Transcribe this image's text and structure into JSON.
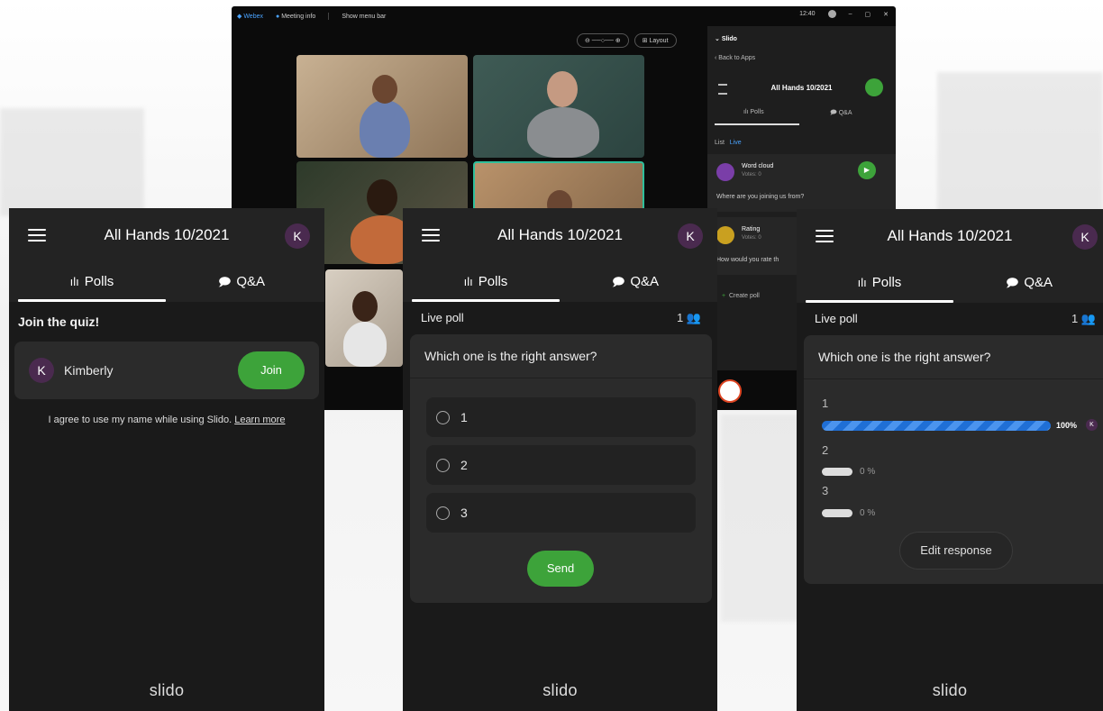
{
  "background_window": {
    "app_name": "Webex",
    "meeting_info": "Meeting info",
    "menu_bar": "Show menu bar",
    "clock": "12:40",
    "layout_label": "Layout",
    "slido_panel": {
      "title": "Slido",
      "back": "Back to Apps",
      "event_title": "All Hands 10/2021",
      "tab_polls": "Polls",
      "tab_qa": "Q&A",
      "filter_list": "List",
      "filter_live": "Live",
      "poll1_name": "Word cloud",
      "poll1_votes": "Votes: 0",
      "poll1_question": "Where are you joining us from?",
      "poll2_name": "Rating",
      "poll2_votes": "Votes: 0",
      "poll2_question": "How would you rate th",
      "create_poll": "Create poll"
    }
  },
  "phone1": {
    "title": "All Hands 10/2021",
    "avatar_initial": "K",
    "tab_polls": "Polls",
    "tab_qa": "Q&A",
    "section_title": "Join the quiz!",
    "user_initial": "K",
    "user_name": "Kimberly",
    "join_button": "Join",
    "consent_text": "I agree to use my name while using Slido.",
    "learn_more": "Learn more",
    "footer_logo": "slido"
  },
  "phone2": {
    "title": "All Hands 10/2021",
    "avatar_initial": "K",
    "tab_polls": "Polls",
    "tab_qa": "Q&A",
    "poll_status": "Live poll",
    "participant_count": "1",
    "question": "Which one is the right answer?",
    "options": [
      "1",
      "2",
      "3"
    ],
    "send_button": "Send",
    "footer_logo": "slido"
  },
  "phone3": {
    "title": "All Hands 10/2021",
    "avatar_initial": "K",
    "tab_polls": "Polls",
    "tab_qa": "Q&A",
    "poll_status": "Live poll",
    "participant_count": "1",
    "question": "Which one is the right answer?",
    "results": [
      {
        "label": "1",
        "percent_text": "100%",
        "percent": 100
      },
      {
        "label": "2",
        "percent_text": "0 %",
        "percent": 0
      },
      {
        "label": "3",
        "percent_text": "0 %",
        "percent": 0
      }
    ],
    "voter_initial": "K",
    "edit_button": "Edit response",
    "footer_logo": "slido"
  },
  "colors": {
    "accent_green": "#3da33a",
    "bar_blue": "#1f6fd6",
    "phone_bg": "#232323",
    "avatar_purple": "#4a2a4f"
  }
}
